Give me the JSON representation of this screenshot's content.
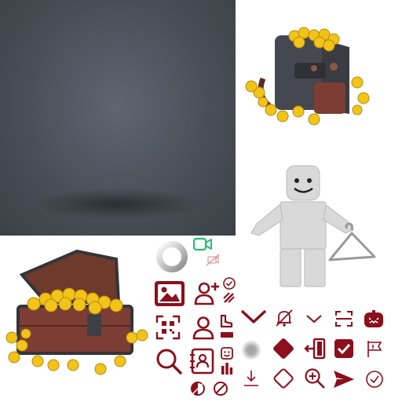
{
  "colors": {
    "accent": "#8b0f1c",
    "accent_dark": "#6e0b15",
    "green": "#1fbf6b",
    "gray": "#b5b5b5",
    "backdrop": "#4a4f57"
  },
  "assets": [
    {
      "name": "backpack-with-coins-illustration"
    },
    {
      "name": "avatar-with-hanger-illustration"
    },
    {
      "name": "treasure-chest-illustration"
    },
    {
      "name": "loading-ring"
    }
  ],
  "icons": [
    "video-camera-icon",
    "camera-off-icon",
    "image-icon",
    "add-user-icon",
    "check-circle-icon",
    "magic-wand-icon",
    "qr-code-icon",
    "user-icon",
    "shoe-icon",
    "face-icon",
    "bar-chart-icon",
    "search-icon",
    "contacts-icon",
    "half-circle-icon",
    "half-circle-slash-icon",
    "chevron-down-bold-icon",
    "notifications-off-icon",
    "chevron-down-icon",
    "scan-icon",
    "pumpkin-icon",
    "blur-circle-icon",
    "diamond-filled-icon",
    "exit-door-icon",
    "checkbox-checked-icon",
    "flag-icon",
    "download-icon",
    "diamond-outline-icon",
    "zoom-in-icon",
    "send-icon",
    "check-outline-icon"
  ]
}
